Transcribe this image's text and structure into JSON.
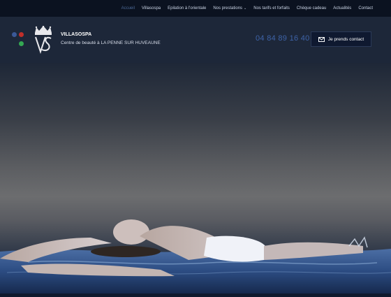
{
  "nav": {
    "items": [
      {
        "label": "Accueil",
        "active": true
      },
      {
        "label": "Villasospa"
      },
      {
        "label": "Epilation à l'orientale"
      },
      {
        "label": "Nos prestations",
        "has_dropdown": true
      },
      {
        "label": "Nos tarifs et forfaits"
      },
      {
        "label": "Chèque cadeau"
      },
      {
        "label": "Actualités"
      },
      {
        "label": "Contact"
      }
    ],
    "dropdown_icon": "chevron-down-icon"
  },
  "social": {
    "icons": [
      "facebook-icon",
      "google-plus-icon",
      "tripadvisor-icon"
    ]
  },
  "brand": {
    "name": "VILLASOSPA",
    "tagline": "Centre de beauté à LA PENNE SUR HUVEAUNE"
  },
  "header": {
    "phone": "04 84 89 16 40",
    "contact_button": "Je prends contact",
    "contact_icon": "envelope-icon"
  },
  "hero": {
    "image": "woman floating in water"
  },
  "colors": {
    "topbar": "#0b1220",
    "header": "#1d2739",
    "accent": "#3e63a8",
    "active_nav": "#4d6a99"
  }
}
